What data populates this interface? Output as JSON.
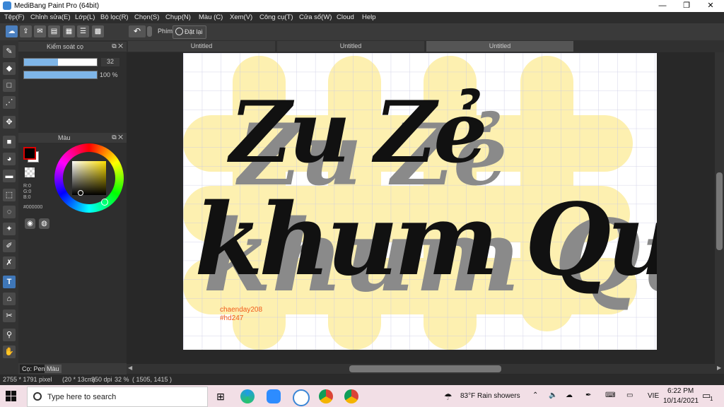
{
  "window": {
    "title": "MediBang Paint Pro (64bit)",
    "minimize": "—",
    "maximize": "❐",
    "close": "✕"
  },
  "menu": [
    "Tệp(F)",
    "Chỉnh sửa(E)",
    "Lớp(L)",
    "Bộ lọc(R)",
    "Chọn(S)",
    "Chụp(N)",
    "Màu (C)",
    "Xem(V)",
    "Công cụ(T)",
    "Cửa sổ(W)",
    "Cloud",
    "Help"
  ],
  "toolbar": {
    "undo": "↶",
    "phim_label": "Phím",
    "reset_label": "Đặt lại"
  },
  "brush_panel": {
    "title": "Kiểm soát cọ",
    "size_value": "32",
    "opacity_value": "100 %",
    "size_fraction": 0.47,
    "opacity_fraction": 1.0
  },
  "color_panel": {
    "title": "Màu",
    "r": "R:0",
    "g": "G:0",
    "b": "B:0",
    "hex": "#000000",
    "fg_color": "#000000",
    "bg_color": "#ffffff"
  },
  "panel_tabs": [
    "Cọ: Pen",
    "Màu"
  ],
  "doc_tabs": [
    "Untitled",
    "Untitled",
    "Untitled"
  ],
  "canvas": {
    "line1": "Zu Zẻ",
    "line2": "khum Quạu",
    "watermark1": "chaenday208",
    "watermark2": "#hd247",
    "highlight_color": "#fdf0b0"
  },
  "status": {
    "size": "2755 * 1791 pixel",
    "cm": "(20 * 13cm)",
    "dpi": "350 dpi",
    "zoom": "32 %",
    "coords": "( 1505, 1415 )"
  },
  "taskbar": {
    "search_placeholder": "Type here to search",
    "weather": "83°F  Rain showers",
    "lang": "VIE",
    "time": "6:22 PM",
    "date": "10/14/2021",
    "notif_count": "1"
  }
}
